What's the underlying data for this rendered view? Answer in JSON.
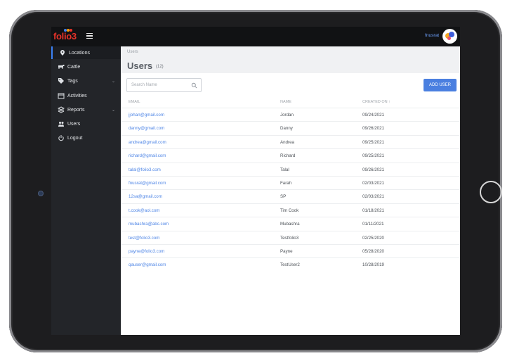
{
  "app": {
    "logo": "folio3",
    "user_name": "fnusrat"
  },
  "sidebar": {
    "items": [
      {
        "label": "Locations",
        "icon": "location-pin-icon",
        "active": true
      },
      {
        "label": "Cattle",
        "icon": "cattle-icon"
      },
      {
        "label": "Tags",
        "icon": "tag-icon",
        "expandable": true
      },
      {
        "label": "Activities",
        "icon": "calendar-icon"
      },
      {
        "label": "Reports",
        "icon": "layers-icon",
        "expandable": true
      },
      {
        "label": "Users",
        "icon": "users-icon"
      },
      {
        "label": "Logout",
        "icon": "power-icon"
      }
    ]
  },
  "main": {
    "breadcrumb": "Users",
    "title": "Users",
    "count": "(12)",
    "search_placeholder": "Search Name",
    "add_button": "ADD USER",
    "columns": {
      "email": "EMAIL",
      "name": "NAME",
      "created": "CREATED ON ↑"
    },
    "rows": [
      {
        "email": "jjohan@gmail.com",
        "name": "Jordan",
        "date": "09/24/2021"
      },
      {
        "email": "danny@gmail.com",
        "name": "Danny",
        "date": "09/26/2021"
      },
      {
        "email": "andrea@gmail.com",
        "name": "Andrea",
        "date": "09/25/2021"
      },
      {
        "email": "richard@gmail.com",
        "name": "Richard",
        "date": "09/25/2021"
      },
      {
        "email": "talal@folio3.com",
        "name": "Talal",
        "date": "09/26/2021"
      },
      {
        "email": "fnusrat@gmail.com",
        "name": "Farah",
        "date": "02/03/2021"
      },
      {
        "email": "12sa@gmail.com",
        "name": "SP",
        "date": "02/03/2021"
      },
      {
        "email": "t.cook@aol.com",
        "name": "Tim Cook",
        "date": "01/18/2021"
      },
      {
        "email": "mubashra@abc.com",
        "name": "Mubashra",
        "date": "01/11/2021"
      },
      {
        "email": "test@folio3.com",
        "name": "Testfolio3",
        "date": "02/25/2020"
      },
      {
        "email": "payne@folio3.com",
        "name": "Payne",
        "date": "05/28/2020"
      },
      {
        "email": "qauser@gmail.com",
        "name": "TestUser2",
        "date": "10/28/2019"
      }
    ]
  },
  "colors": {
    "accent": "#4a7fe0",
    "sidebar": "#232529",
    "topbar": "#111214",
    "logo": "#e8332a"
  }
}
